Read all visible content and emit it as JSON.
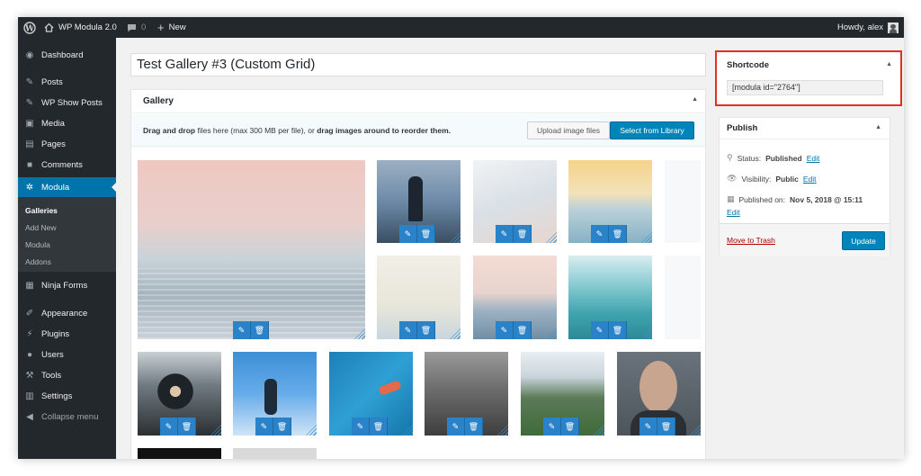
{
  "admin_bar": {
    "site_name": "WP Modula 2.0",
    "comments_count": "0",
    "new_label": "New",
    "howdy": "Howdy, alex"
  },
  "sidebar": {
    "items": [
      {
        "label": "Dashboard",
        "icon": "dashboard-icon"
      },
      {
        "label": "Posts",
        "icon": "pin-icon"
      },
      {
        "label": "WP Show Posts",
        "icon": "pin-icon"
      },
      {
        "label": "Media",
        "icon": "media-icon"
      },
      {
        "label": "Pages",
        "icon": "page-icon"
      },
      {
        "label": "Comments",
        "icon": "comment-icon"
      },
      {
        "label": "Modula",
        "icon": "gear-icon"
      },
      {
        "label": "Ninja Forms",
        "icon": "forms-icon"
      },
      {
        "label": "Appearance",
        "icon": "brush-icon"
      },
      {
        "label": "Plugins",
        "icon": "plug-icon"
      },
      {
        "label": "Users",
        "icon": "user-icon"
      },
      {
        "label": "Tools",
        "icon": "wrench-icon"
      },
      {
        "label": "Settings",
        "icon": "settings-icon"
      },
      {
        "label": "Collapse menu",
        "icon": "collapse-icon"
      }
    ],
    "submenu": [
      "Galleries",
      "Add New",
      "Modula",
      "Addons"
    ]
  },
  "editor": {
    "title": "Test Gallery #3 (Custom Grid)",
    "gallery_heading": "Gallery",
    "drag_bold1": "Drag and drop",
    "drag_mid": " files here (max 300 MB per file), or ",
    "drag_bold2": "drag images around to reorder them.",
    "upload_label": "Upload image files",
    "library_label": "Select from Library"
  },
  "shortcode": {
    "heading": "Shortcode",
    "value": "[modula id=\"2764\"]"
  },
  "publish": {
    "heading": "Publish",
    "status_label": "Status:",
    "status_value": "Published",
    "visibility_label": "Visibility:",
    "visibility_value": "Public",
    "published_label": "Published on:",
    "published_value": "Nov 5, 2018 @ 15:11",
    "edit_label": "Edit",
    "trash_label": "Move to Trash",
    "update_label": "Update"
  },
  "colors": {
    "accent": "#0073aa",
    "highlight": "#e0301e",
    "adminbar": "#23282d"
  }
}
